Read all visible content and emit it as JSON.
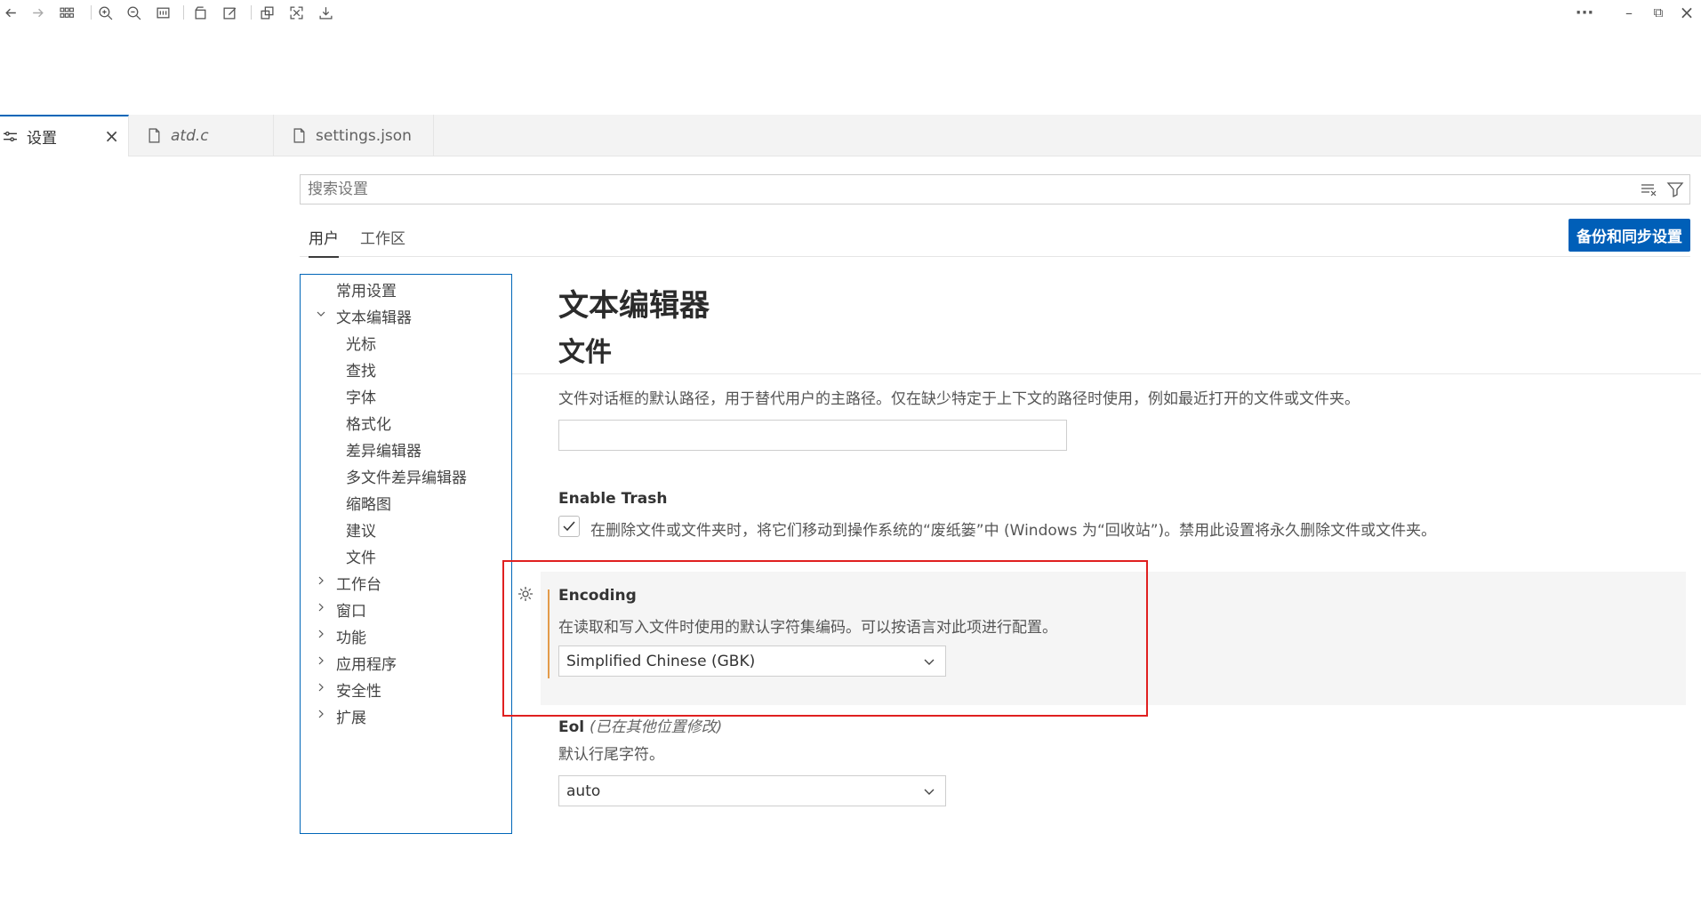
{
  "tabs": [
    {
      "label": "设置",
      "icon": "settings-icon",
      "close": "×",
      "active": true
    },
    {
      "label": "atd.c",
      "icon": "file-icon",
      "italic": true
    },
    {
      "label": "settings.json",
      "icon": "file-icon"
    }
  ],
  "window_controls": {
    "more": "···",
    "minimize": "–",
    "restore": "⧉",
    "close": "×"
  },
  "search": {
    "placeholder": "搜索设置"
  },
  "scope": {
    "user": "用户",
    "workspace": "工作区",
    "sync_button": "备份和同步设置"
  },
  "toc": {
    "items": [
      {
        "label": "常用设置"
      },
      {
        "label": "文本编辑器",
        "expanded": true
      },
      {
        "label": "光标"
      },
      {
        "label": "查找"
      },
      {
        "label": "字体"
      },
      {
        "label": "格式化"
      },
      {
        "label": "差异编辑器"
      },
      {
        "label": "多文件差异编辑器"
      },
      {
        "label": "缩略图"
      },
      {
        "label": "建议"
      },
      {
        "label": "文件"
      },
      {
        "label": "工作台",
        "collapsed": true
      },
      {
        "label": "窗口",
        "collapsed": true
      },
      {
        "label": "功能",
        "collapsed": true
      },
      {
        "label": "应用程序",
        "collapsed": true
      },
      {
        "label": "安全性",
        "collapsed": true
      },
      {
        "label": "扩展",
        "collapsed": true
      }
    ]
  },
  "content": {
    "section_title": "文本编辑器",
    "subsection_title": "文件",
    "dialog_default_path_desc": "文件对话框的默认路径，用于替代用户的主路径。仅在缺少特定于上下文的路径时使用，例如最近打开的文件或文件夹。",
    "dialog_default_path_value": "",
    "enable_trash": {
      "title": "Enable Trash",
      "checked": true,
      "desc": "在删除文件或文件夹时，将它们移动到操作系统的“废纸篓”中 (Windows 为“回收站”)。禁用此设置将永久删除文件或文件夹。"
    },
    "encoding": {
      "title": "Encoding",
      "desc": "在读取和写入文件时使用的默认字符集编码。可以按语言对此项进行配置。",
      "value": "Simplified Chinese (GBK)"
    },
    "eol": {
      "title": "Eol",
      "note": "(已在其他位置修改)",
      "desc": "默认行尾字符。",
      "value": "auto"
    }
  },
  "colors": {
    "accent": "#005fb8",
    "highlight": "#e02020",
    "modified_bar": "#e39b4a"
  }
}
